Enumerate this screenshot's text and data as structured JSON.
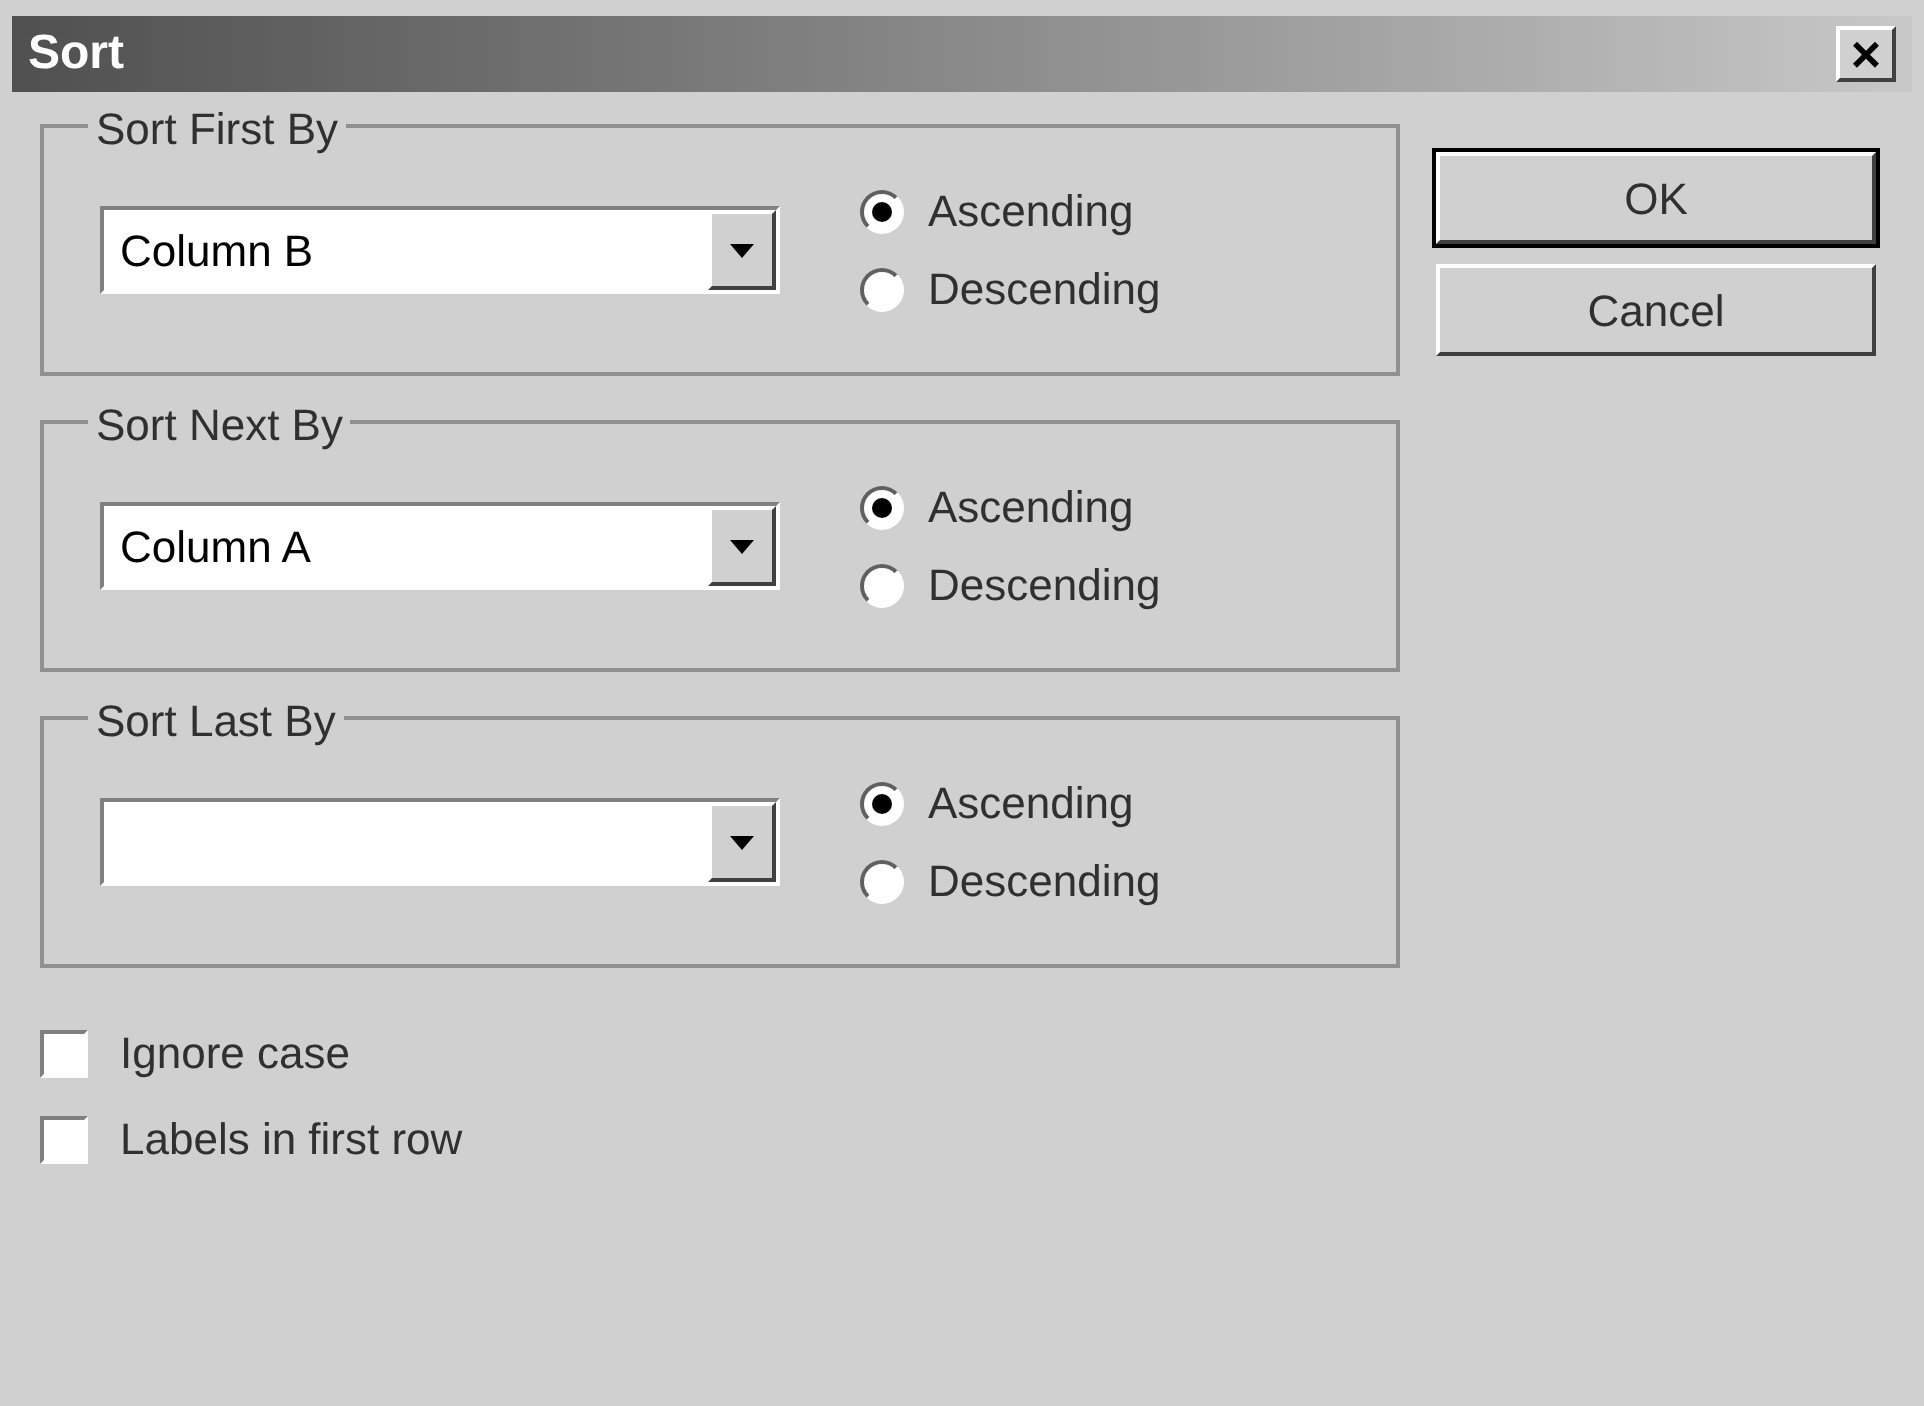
{
  "window": {
    "title": "Sort",
    "close": "×"
  },
  "groups": [
    {
      "title": "Sort First By",
      "value": "Column B",
      "options": [
        {
          "label": "Ascending",
          "selected": true
        },
        {
          "label": "Descending",
          "selected": false
        }
      ]
    },
    {
      "title": "Sort Next By",
      "value": "Column A",
      "options": [
        {
          "label": "Ascending",
          "selected": true
        },
        {
          "label": "Descending",
          "selected": false
        }
      ]
    },
    {
      "title": "Sort Last By",
      "options": [
        {
          "label": "Ascending",
          "selected": true
        },
        {
          "label": "Descending",
          "selected": false
        }
      ]
    }
  ],
  "checkboxes": [
    {
      "label": "Ignore case",
      "checked": false
    },
    {
      "label": "Labels in first row",
      "checked": false
    }
  ],
  "buttons": [
    {
      "label": "OK",
      "default": true
    },
    {
      "label": "Cancel",
      "default": false
    }
  ]
}
